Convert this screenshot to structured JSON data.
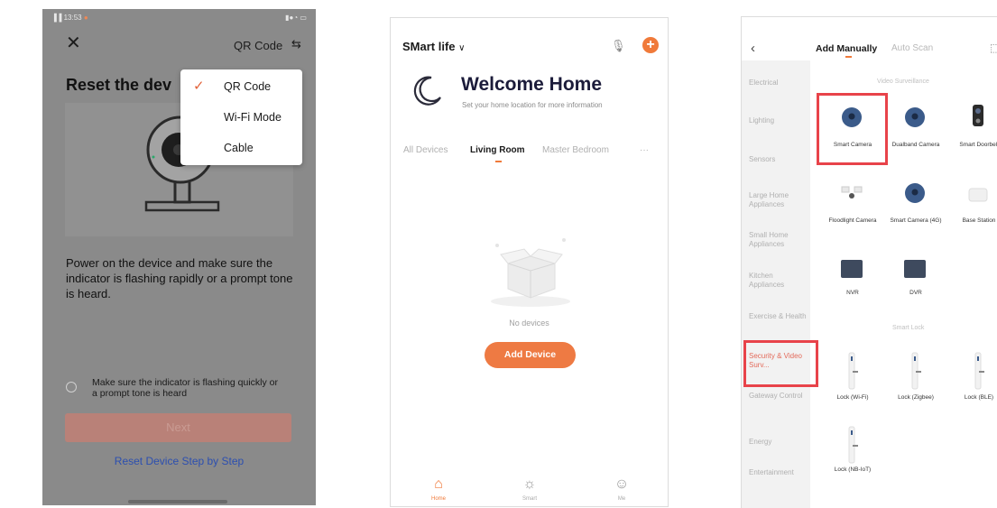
{
  "panel1": {
    "status_time": "13:53",
    "status_icons_right": "▮●◔ ▭",
    "close_icon": "close-icon",
    "mode_selector": "QR Code",
    "mode_swap_icon": "swap-icon",
    "title": "Reset the dev",
    "description": "Power on the device and make sure the indicator is flashing rapidly or a prompt tone is heard.",
    "confirm_text": "Make sure the indicator is flashing quickly or a prompt tone is heard",
    "next_label": "Next",
    "reset_link": "Reset Device Step by Step",
    "dropdown": {
      "items": [
        {
          "label": "QR Code",
          "selected": true
        },
        {
          "label": "Wi-Fi Mode",
          "selected": false
        },
        {
          "label": "Cable",
          "selected": false
        }
      ]
    }
  },
  "panel2": {
    "home_name": "SMart life",
    "welcome_title": "Welcome Home",
    "welcome_sub": "Set your home location for more information",
    "tabs": [
      "All Devices",
      "Living Room",
      "Master Bedroom",
      "···"
    ],
    "active_tab": "Living Room",
    "empty_text": "No devices",
    "add_button": "Add Device",
    "nav": [
      "Home",
      "Smart",
      "Me"
    ],
    "accent": "#f07a3a"
  },
  "panel3": {
    "tabs": {
      "active": "Add Manually",
      "inactive": "Auto Scan"
    },
    "categories": [
      "Electrical",
      "Lighting",
      "Sensors",
      "Large Home Appliances",
      "Small Home Appliances",
      "Kitchen Appliances",
      "Exercise & Health",
      "Security & Video Surv...",
      "Gateway Control",
      "Energy",
      "Entertainment"
    ],
    "active_category": "Security & Video Surv...",
    "section_video": "Video Surveillance",
    "section_lock": "Smart Lock",
    "devices": [
      {
        "label": "Smart Camera",
        "icon": "camera-icon"
      },
      {
        "label": "Dualband Camera",
        "icon": "camera-icon"
      },
      {
        "label": "Smart Doorbell",
        "icon": "doorbell-icon"
      },
      {
        "label": "Floodlight Camera",
        "icon": "floodlight-icon"
      },
      {
        "label": "Smart Camera (4G)",
        "icon": "camera-icon"
      },
      {
        "label": "Base Station",
        "icon": "base-station-icon"
      },
      {
        "label": "NVR",
        "icon": "nvr-icon"
      },
      {
        "label": "DVR",
        "icon": "dvr-icon"
      }
    ],
    "locks": [
      {
        "label": "Lock (Wi-Fi)"
      },
      {
        "label": "Lock (Zigbee)"
      },
      {
        "label": "Lock (BLE)"
      },
      {
        "label": "Lock (NB-IoT)"
      }
    ],
    "highlight_color": "#e8434a"
  }
}
